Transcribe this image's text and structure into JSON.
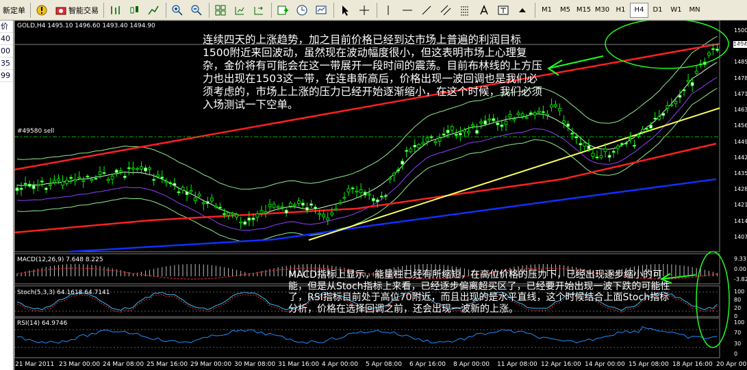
{
  "toolbar": {
    "new_order_label": "新定单",
    "expert_label": "智能交易",
    "timeframes": [
      "M1",
      "M5",
      "M15",
      "M30",
      "H1",
      "H4",
      "D1",
      "W1",
      "MN"
    ],
    "active_timeframe": "H4",
    "icons": [
      "new-order-icon",
      "expert-warning-icon",
      "expert-advisors-icon",
      "bar-chart-icon",
      "candlestick-icon",
      "line-chart-icon",
      "zoom-in-icon",
      "zoom-out-icon",
      "tile-windows-icon",
      "autoscroll-icon",
      "chart-shift-icon",
      "indicators-icon",
      "periods-icon",
      "templates-icon",
      "cursor-icon",
      "crosshair-icon",
      "vertical-line-icon",
      "horizontal-line-icon",
      "trendline-icon",
      "channel-icon",
      "fibonacci-icon",
      "text-icon",
      "text-label-icon",
      "arrows-icon"
    ]
  },
  "left_panel": {
    "rows": [
      "价",
      "40",
      "00",
      "35",
      "99"
    ]
  },
  "chart": {
    "header": "GOLD,H4  1495.10 1496.60 1493.40 1494.90",
    "sell_label": "#49580 sell",
    "price_box": "1494",
    "y_labels_main": [
      "1500",
      "1494",
      "1485",
      "1478",
      "1471",
      "1463",
      "1456",
      "1449",
      "1442",
      "1435",
      "1428",
      "1421",
      "1414",
      "1407"
    ],
    "macd_label": "MACD(12,26,9) 7.648 8.225",
    "macd_y": [
      "9.337",
      "0.00",
      "-3.82"
    ],
    "stoch_label": "Stoch(5,3,3) 64.1618 64.7141",
    "stoch_y": [
      "100",
      "80",
      "20",
      "0"
    ],
    "rsi_label": "RSI(14) 64.9746",
    "rsi_y": [
      "100",
      "70",
      "30",
      "0"
    ],
    "x_labels": [
      "21 Mar 2011",
      "23 Mar 00:00",
      "24 Mar 08:00",
      "25 Mar 16:00",
      "29 Mar 00:00",
      "30 Mar 08:00",
      "31 Mar 16:00",
      "4 Apr 00:00",
      "5 Apr 08:00",
      "6 Apr 16:00",
      "8 Apr 00:00",
      "11 Apr 08:00",
      "12 Apr 16:00",
      "14 Apr 00:00",
      "15 Apr 08:00",
      "18 Apr 16:00",
      "20 Apr 00:00"
    ],
    "colors": {
      "background": "#000000",
      "candle": "#00ff00",
      "trend_red": "#ff2020",
      "trend_yellow": "#ffff60",
      "ma_blue": "#1030ff",
      "ma_purple": "#9040ff",
      "bands": "#90ee90",
      "annotation": "#ffffff",
      "rsi": "#1e90ff"
    }
  },
  "annotations": {
    "note1": "连续四天的上涨趋势，加之目前价格已经到达市场上普遍的利润目标1500附近来回波动，虽然现在波动幅度很小，但这表明市场上心理复杂，金价将有可能会在这一带展开一段时间的震荡。目前布林线的上方压力也出现在1503这一带，在连串新高后，价格出现一波回调也是我们必须考虑的，市场上上涨的压力已经开始逐渐缩小，在这个时候，我们必须入场测试一下空单。",
    "note2": "MACD指标上显示，能量柱已经有所缩短，在高位价格的压力下，已经出现逐步缩小的可能，但是从Stoch指标上来看，已经逐步偏离超买区了，已经要开始出现一波下跌的可能性了，RSI指标目前处于高位70附近，而且出现的是水平直线，这个时候结合上面Stoch指标分析，价格在选择回调之前，还会出现一波新的上涨。"
  }
}
